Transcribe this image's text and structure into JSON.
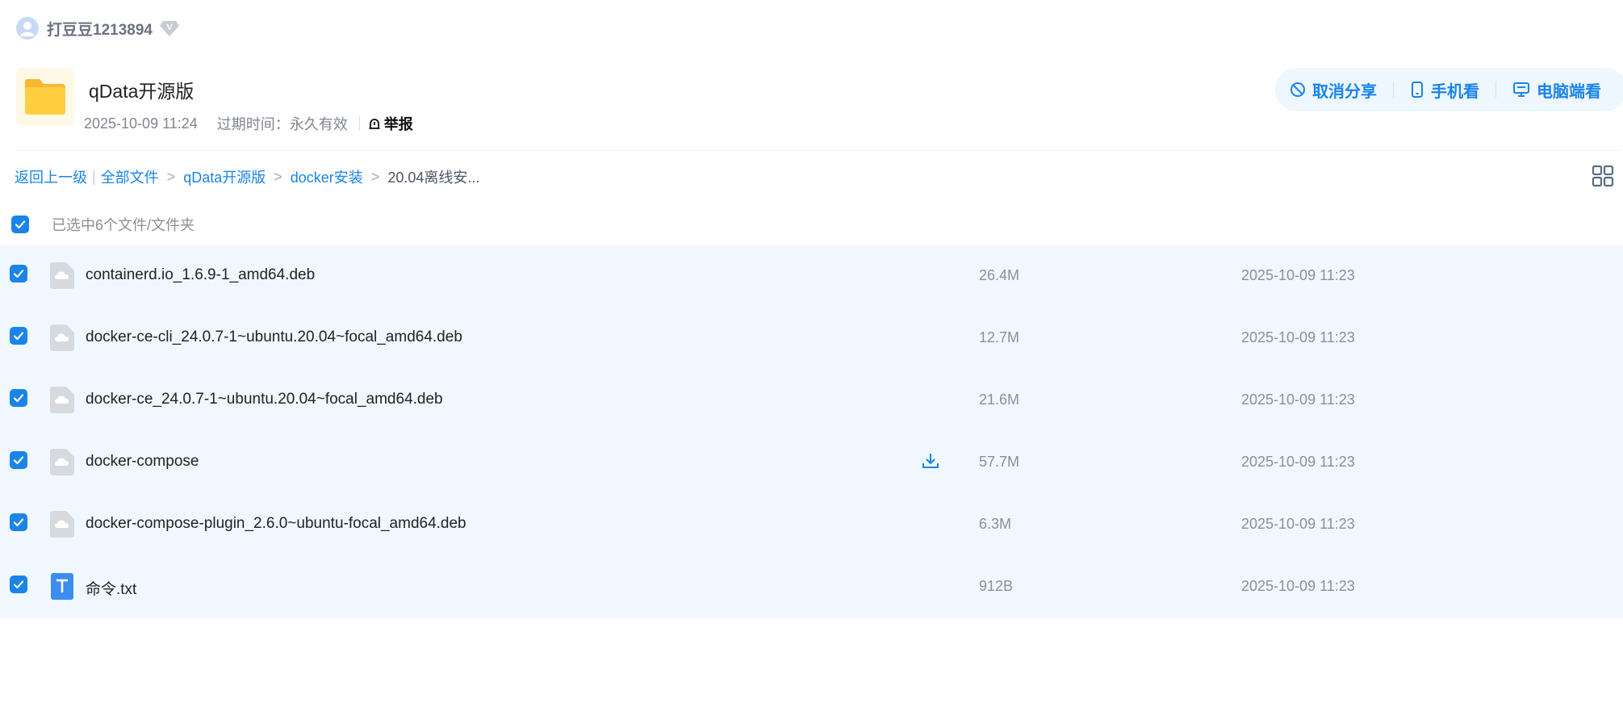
{
  "user": {
    "name": "打豆豆1213894",
    "vip_badge": "V"
  },
  "share": {
    "title": "qData开源版",
    "date": "2025-10-09 11:24",
    "expire_label": "过期时间：",
    "expire_value": "永久有效",
    "report_label": "举报"
  },
  "actions": {
    "cancel_share": "取消分享",
    "mobile_view": "手机看",
    "pc_view": "电脑端看"
  },
  "breadcrumb": {
    "back": "返回上一级",
    "all_files": "全部文件",
    "level1": "qData开源版",
    "level2": "docker安装",
    "current": "20.04离线安..."
  },
  "selection": {
    "text": "已选中6个文件/文件夹"
  },
  "colors": {
    "accent": "#1a84e8",
    "row_bg": "#f0f7fe",
    "action_bg": "#eef6fe"
  },
  "files": [
    {
      "name": "containerd.io_1.6.9-1_amd64.deb",
      "size": "26.4M",
      "time": "2025-10-09 11:23",
      "icon": "cloud-file-icon"
    },
    {
      "name": "docker-ce-cli_24.0.7-1~ubuntu.20.04~focal_amd64.deb",
      "size": "12.7M",
      "time": "2025-10-09 11:23",
      "icon": "cloud-file-icon"
    },
    {
      "name": "docker-ce_24.0.7-1~ubuntu.20.04~focal_amd64.deb",
      "size": "21.6M",
      "time": "2025-10-09 11:23",
      "icon": "cloud-file-icon"
    },
    {
      "name": "docker-compose",
      "size": "57.7M",
      "time": "2025-10-09 11:23",
      "icon": "cloud-file-icon"
    },
    {
      "name": "docker-compose-plugin_2.6.0~ubuntu-focal_amd64.deb",
      "size": "6.3M",
      "time": "2025-10-09 11:23",
      "icon": "cloud-file-icon"
    },
    {
      "name": "命令.txt",
      "size": "912B",
      "time": "2025-10-09 11:23",
      "icon": "text-file-icon"
    }
  ]
}
